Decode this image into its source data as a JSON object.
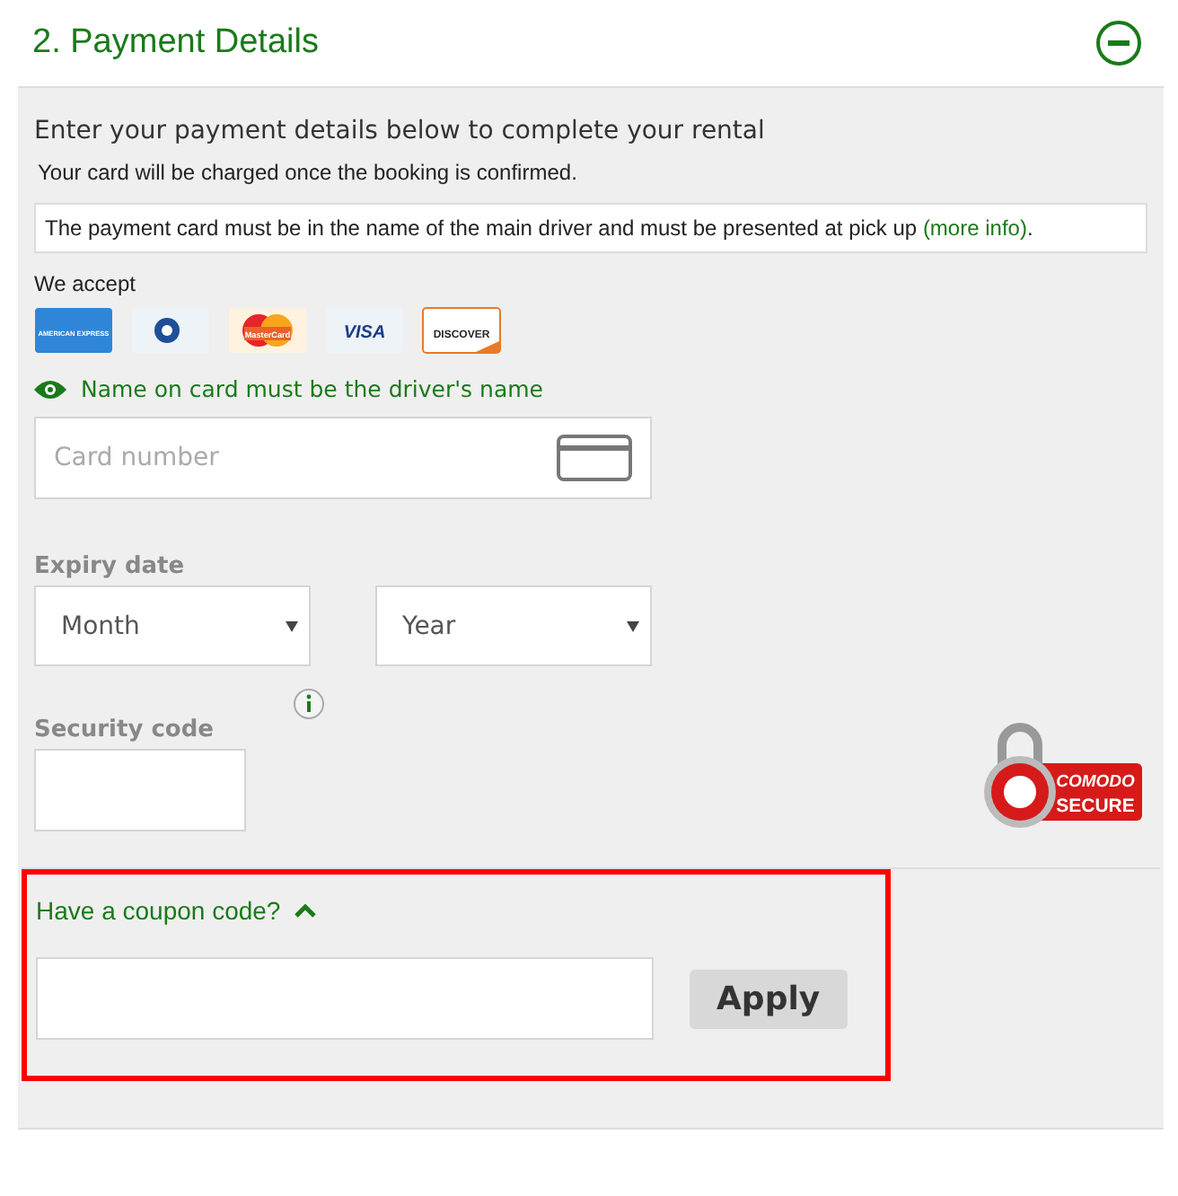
{
  "section": {
    "title": "2. Payment Details",
    "expanded": true
  },
  "intro": "Enter your payment details below to complete your rental",
  "charge_note": "Your card will be charged once the booking is confirmed.",
  "notice": {
    "text": "The payment card must be in the name of the main driver and must be presented at pick up ",
    "link": "(more info)",
    "after": "."
  },
  "accepted_label": "We accept",
  "cards": [
    {
      "kind": "amex",
      "label": "AMERICAN EXPRESS"
    },
    {
      "kind": "diners"
    },
    {
      "kind": "mastercard",
      "label": "MasterCard"
    },
    {
      "kind": "visa",
      "label": "VISA"
    },
    {
      "kind": "discover",
      "label": "DISCOVER"
    }
  ],
  "name_hint": "Name on card must be the driver's name",
  "card_number": {
    "placeholder": "Card number"
  },
  "expiry": {
    "label": "Expiry date",
    "month": "Month",
    "year": "Year"
  },
  "security_code": {
    "label": "Security code"
  },
  "secure_badge": {
    "line_1": "COMODO",
    "line_2": "SECURE"
  },
  "coupon": {
    "label": "Have a coupon code?",
    "expanded": true,
    "highlighted": true,
    "button": "Apply"
  }
}
